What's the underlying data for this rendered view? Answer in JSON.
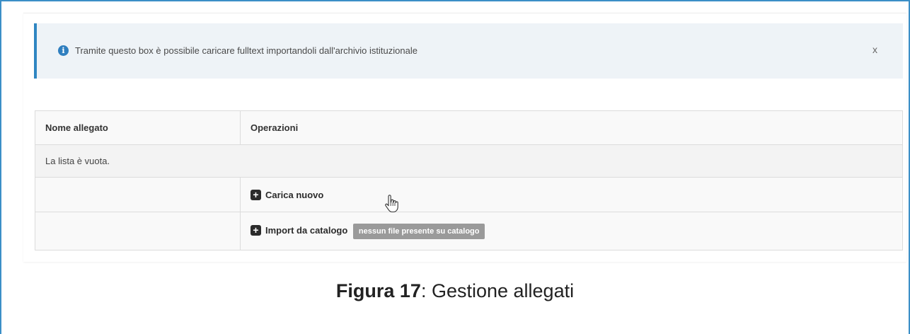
{
  "alert": {
    "icon": "info-icon",
    "text": "Tramite questo box è possibile caricare fulltext importandoli dall'archivio istituzionale",
    "close_label": "x"
  },
  "table": {
    "headers": [
      "Nome allegato",
      "Operazioni"
    ],
    "empty_message": "La lista è vuota.",
    "actions": [
      {
        "icon": "plus-square-icon",
        "label": "Carica nuovo"
      },
      {
        "icon": "plus-square-icon",
        "label": "Import da catalogo",
        "badge": "nessun file presente su catalogo"
      }
    ]
  },
  "caption": {
    "label": "Figura 17",
    "text": ": Gestione allegati"
  },
  "colors": {
    "frame_border": "#3b8fc7",
    "alert_accent": "#2f86c2",
    "alert_bg": "#eef3f7",
    "badge_bg": "#9a9a9a"
  }
}
